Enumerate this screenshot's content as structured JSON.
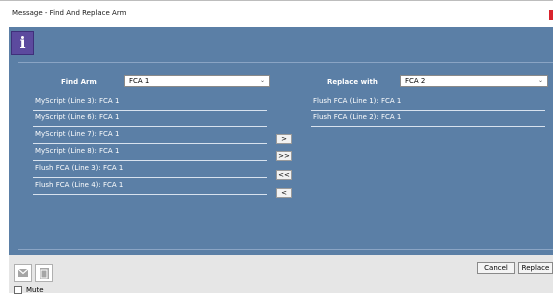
{
  "window": {
    "title": "Message - Find And Replace Arm"
  },
  "icons": {
    "info": "info-icon",
    "email": "envelope-icon",
    "copy": "copy-icon"
  },
  "info_glyph": "i",
  "find": {
    "label": "Find Arm",
    "value": "FCA 1"
  },
  "replace": {
    "label": "Replace with",
    "value": "FCA 2"
  },
  "left_items": [
    "MyScript (Line 3): FCA 1",
    "MyScript (Line 6): FCA 1",
    "MyScript (Line 7): FCA 1",
    "MyScript (Line 8): FCA 1",
    "Flush FCA (Line 3): FCA 1",
    "Flush FCA (Line 4): FCA 1"
  ],
  "right_items": [
    "Flush FCA (Line 1): FCA 1",
    "Flush FCA (Line 2): FCA 1"
  ],
  "move_buttons": {
    "move_one": ">",
    "move_all": ">>",
    "remove_all": "<<",
    "remove_one": "<"
  },
  "buttons": {
    "cancel": "Cancel",
    "replace": "Replace"
  },
  "mute": {
    "label": "Mute",
    "checked": false
  },
  "colors": {
    "panel": "#5b7fa6",
    "info_icon": "#5c4a9e",
    "close": "#d9232d"
  }
}
